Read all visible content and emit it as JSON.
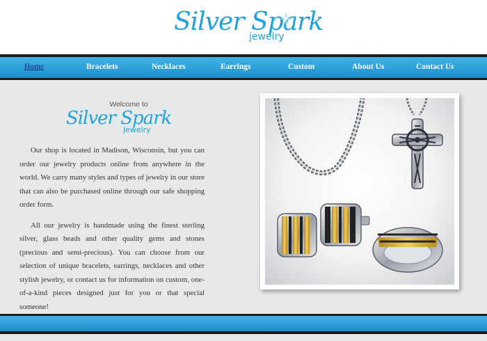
{
  "header": {
    "logo_main": "Silver Spark",
    "logo_sub": "jewelry"
  },
  "nav": {
    "items": [
      {
        "label": "Home",
        "active": true
      },
      {
        "label": "Bracelets"
      },
      {
        "label": "Necklaces"
      },
      {
        "label": "Earrings"
      },
      {
        "label": "Custom"
      },
      {
        "label": "About Us"
      },
      {
        "label": "Contact Us"
      }
    ]
  },
  "main": {
    "welcome_to": "Welcome to",
    "welcome_main": "Silver Spark",
    "welcome_sub": "jewelry",
    "paragraphs": [
      "Our shop is located in Madison, Wisconsin, but you can order our jewelry products online from anywhere in the world. We carry many styles and types of jewelry in our store that can also be purchased online through our safe shopping order form.",
      "All our jewelry is handmade using the finest sterling silver, glass beads and other quality gems and stones (precious and semi-precious). You can choose from our selection of unique bracelets, earrings, necklaces and other stylish jewelry, or contact us for information on custom, one-of-a-kind pieces designed just for you or that special someone!"
    ]
  },
  "colors": {
    "accent": "#1fa3d8",
    "nav_gradient_top": "#43b3e6",
    "nav_gradient_bottom": "#1c8fcd",
    "content_bg": "#e7e8ea",
    "active_link": "#0d2a78"
  },
  "icons": [
    "sparkle-icon"
  ]
}
